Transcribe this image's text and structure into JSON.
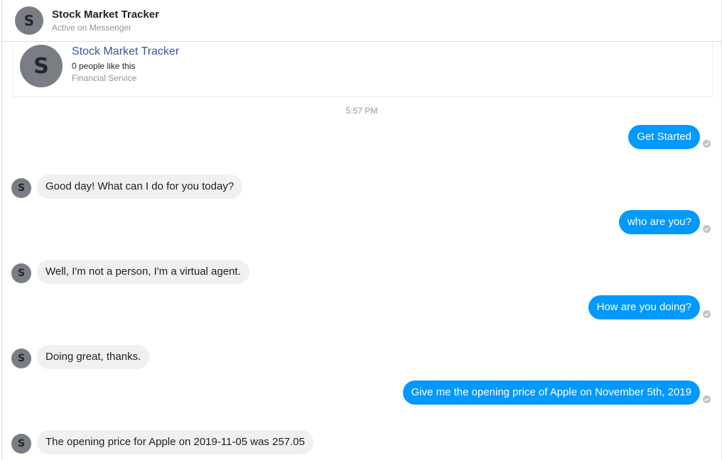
{
  "header": {
    "avatar_letter": "S",
    "title": "Stock Market Tracker",
    "status": "Active on Messenger"
  },
  "page_card": {
    "avatar_letter": "S",
    "name": "Stock Market Tracker",
    "likes": "0 people like this",
    "category": "Financial Service"
  },
  "timestamp": "5:57 PM",
  "messages": [
    {
      "direction": "outgoing",
      "text": "Get Started"
    },
    {
      "direction": "incoming",
      "avatar_letter": "S",
      "text": "Good day! What can I do for you today?"
    },
    {
      "direction": "outgoing",
      "text": "who are you?"
    },
    {
      "direction": "incoming",
      "avatar_letter": "S",
      "text": "Well, I'm not a person, I'm a virtual agent."
    },
    {
      "direction": "outgoing",
      "text": "How are you doing?"
    },
    {
      "direction": "incoming",
      "avatar_letter": "S",
      "text": "Doing great, thanks."
    },
    {
      "direction": "outgoing",
      "text": "Give me the opening price of Apple on November 5th, 2019"
    },
    {
      "direction": "incoming",
      "avatar_letter": "S",
      "text": "The opening price for Apple on 2019-11-05 was 257.05"
    }
  ],
  "colors": {
    "outgoing_bubble": "#0099ff",
    "incoming_bubble": "#f1f0f0",
    "page_link": "#385898",
    "avatar": "#7a7d83"
  },
  "icons": {
    "seen": "check-circle-icon"
  }
}
